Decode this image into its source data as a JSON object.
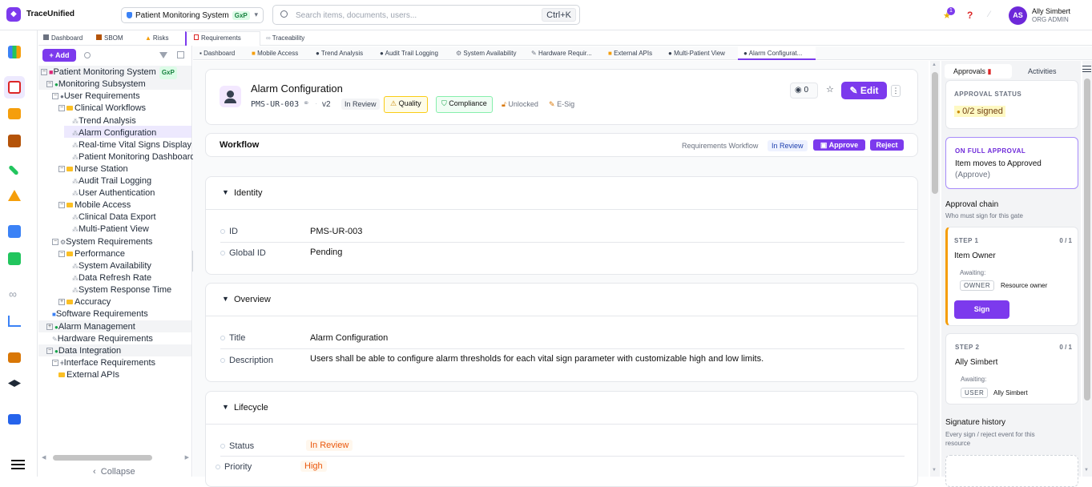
{
  "app": {
    "name": "TraceUnified",
    "logo_glyph": "◆"
  },
  "project": {
    "name": "Patient Monitoring System",
    "badge": "GxP"
  },
  "search": {
    "placeholder": "Search items, documents, users...",
    "shortcut": "Ctrl+K"
  },
  "notifications": {
    "count": "1"
  },
  "user": {
    "initials": "AS",
    "name": "Ally Simbert",
    "role": "ORG ADMIN"
  },
  "primary_tabs": [
    {
      "label": "Dashboard"
    },
    {
      "label": "SBOM"
    },
    {
      "label": "Risks"
    },
    {
      "label": "Requirements"
    },
    {
      "label": "Traceability"
    }
  ],
  "secondary_tabs": [
    {
      "label": "Dashboard"
    },
    {
      "label": "Mobile Access"
    },
    {
      "label": "Trend Analysis"
    },
    {
      "label": "Audit Trail Logging"
    },
    {
      "label": "System Availability"
    },
    {
      "label": "Hardware Requir..."
    },
    {
      "label": "External APIs"
    },
    {
      "label": "Multi-Patient View"
    },
    {
      "label": "Alarm Configurat..."
    }
  ],
  "tree": {
    "add_label": "+ Add",
    "collapse_label": "Collapse",
    "nodes": [
      {
        "label": "Patient Monitoring System",
        "badge": "GxP"
      },
      {
        "label": "Monitoring Subsystem"
      },
      {
        "label": "User Requirements"
      },
      {
        "label": "Clinical Workflows"
      },
      {
        "label": "Trend Analysis"
      },
      {
        "label": "Alarm Configuration"
      },
      {
        "label": "Real-time Vital Signs Display"
      },
      {
        "label": "Patient Monitoring Dashboard"
      },
      {
        "label": "Nurse Station"
      },
      {
        "label": "Audit Trail Logging"
      },
      {
        "label": "User Authentication"
      },
      {
        "label": "Mobile Access"
      },
      {
        "label": "Clinical Data Export"
      },
      {
        "label": "Multi-Patient View"
      },
      {
        "label": "System Requirements"
      },
      {
        "label": "Performance"
      },
      {
        "label": "System Availability"
      },
      {
        "label": "Data Refresh Rate"
      },
      {
        "label": "System Response Time"
      },
      {
        "label": "Accuracy"
      },
      {
        "label": "Software Requirements"
      },
      {
        "label": "Alarm Management"
      },
      {
        "label": "Hardware Requirements"
      },
      {
        "label": "Data Integration"
      },
      {
        "label": "Interface Requirements"
      },
      {
        "label": "External APIs"
      }
    ]
  },
  "item": {
    "title": "Alarm Configuration",
    "code": "PMS-UR-003",
    "version": "v2",
    "status": "In Review",
    "tag_quality": "Quality",
    "tag_compliance": "Compliance",
    "lock_state": "Unlocked",
    "esig": "E-Sig",
    "watchers": "0",
    "edit_label": "Edit"
  },
  "workflow": {
    "title": "Workflow",
    "name": "Requirements Workflow",
    "state": "In Review",
    "approve_label": "Approve",
    "reject_label": "Reject"
  },
  "identity": {
    "title": "Identity",
    "fields": [
      {
        "label": "ID",
        "value": "PMS-UR-003"
      },
      {
        "label": "Global ID",
        "value": "Pending"
      }
    ]
  },
  "overview": {
    "title": "Overview",
    "fields": [
      {
        "label": "Title",
        "value": "Alarm Configuration"
      },
      {
        "label": "Description",
        "value": "Users shall be able to configure alarm thresholds for each vital sign parameter with customizable high and low limits."
      }
    ]
  },
  "lifecycle": {
    "title": "Lifecycle",
    "fields": [
      {
        "label": "Status",
        "value": "In Review"
      },
      {
        "label": "Priority",
        "value": "High"
      }
    ]
  },
  "right_panel": {
    "tab_approvals": "Approvals",
    "tab_activities": "Activities",
    "approval_status_label": "APPROVAL STATUS",
    "approval_status_value": "0/2 signed",
    "on_full_label": "ON FULL APPROVAL",
    "on_full_value": "Item moves to Approved",
    "on_full_sub": "(Approve)",
    "chain_title": "Approval chain",
    "chain_sub": "Who must sign for this gate",
    "steps": [
      {
        "step": "STEP 1",
        "count": "0 / 1",
        "name": "Item Owner",
        "awaiting": "Awaiting:",
        "role": "OWNER",
        "who": "Resource owner",
        "sign_label": "Sign"
      },
      {
        "step": "STEP 2",
        "count": "0 / 1",
        "name": "Ally Simbert",
        "awaiting": "Awaiting:",
        "role": "USER",
        "who": "Ally Simbert"
      }
    ],
    "sig_title": "Signature history",
    "sig_sub": "Every sign / reject event for this resource"
  },
  "colors": {
    "accent": "#7c3aed",
    "review_bg": "#fff7ed",
    "review_fg": "#ea580c"
  }
}
